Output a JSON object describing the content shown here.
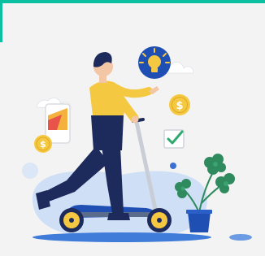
{
  "illustration": {
    "subject": "person-riding-kick-scooter",
    "icons": [
      "lightbulb-icon",
      "dollar-coin-icon",
      "checkmark-icon",
      "phone-chart-icon",
      "cloud-icon",
      "plant-icon"
    ]
  },
  "colors": {
    "accent": "#0bbfa1",
    "background": "#f4f3f3",
    "shirt": "#f5c842",
    "pants": "#1d2a5c",
    "blob": "#cfe0f6",
    "coin": "#f5c842",
    "plant": "#2f8a5e",
    "pot": "#1f4fb3"
  }
}
